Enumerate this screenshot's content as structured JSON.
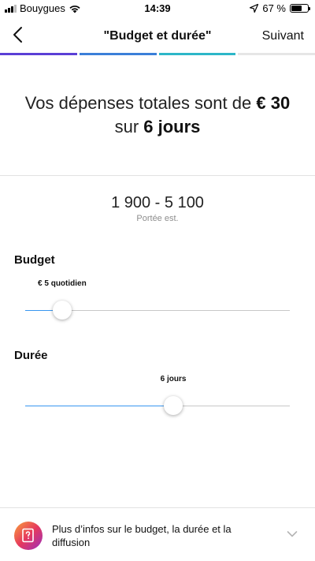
{
  "status_bar": {
    "carrier": "Bouygues",
    "time": "14:39",
    "battery_percent": "67 %",
    "battery_level": 0.67
  },
  "nav": {
    "back_icon": "chevron-left-icon",
    "title": "\"Budget et durée\"",
    "next_label": "Suivant"
  },
  "progress": {
    "steps": [
      {
        "color": "#5b3fd6"
      },
      {
        "color": "#3b7fd9"
      },
      {
        "color": "#2db7c8"
      },
      {
        "color": "#e6e6e6"
      }
    ]
  },
  "summary": {
    "line1_prefix": "Vos dépenses totales sont de",
    "total_amount": "€ 30",
    "line2_prefix": "sur",
    "duration_text": "6 jours"
  },
  "reach": {
    "range": "1 900 - 5 100",
    "label": "Portée est."
  },
  "budget": {
    "label": "Budget",
    "value_label": "€ 5 quotidien",
    "slider_fraction": 0.14
  },
  "duration": {
    "label": "Durée",
    "value_label": "6 jours",
    "slider_fraction": 0.56
  },
  "footer": {
    "icon": "book-question-icon",
    "text": "Plus d’infos sur le budget, la durée et la diffusion",
    "chevron_icon": "chevron-down-icon"
  },
  "colors": {
    "slider_fill": "#3897f0"
  }
}
